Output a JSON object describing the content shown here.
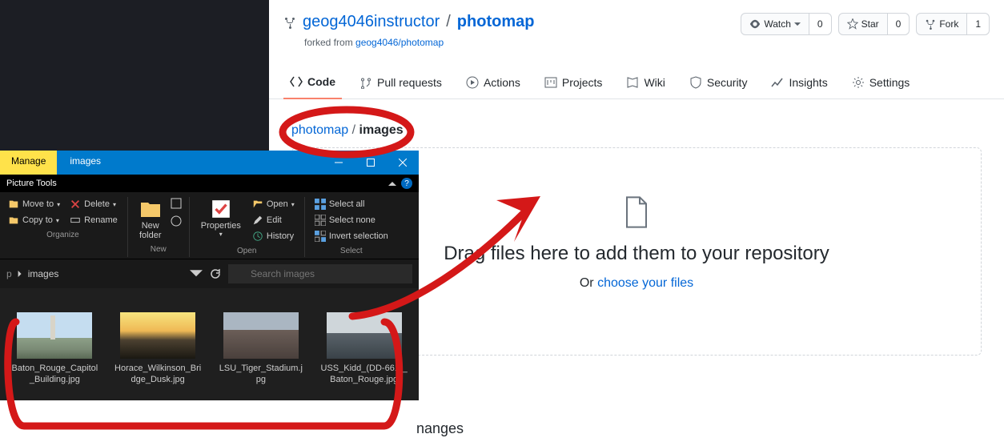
{
  "github": {
    "owner": "geog4046instructor",
    "repo": "photomap",
    "forked_from_prefix": "forked from ",
    "forked_from": "geog4046/photomap",
    "actions": {
      "watch": {
        "label": "Watch",
        "count": "0"
      },
      "star": {
        "label": "Star",
        "count": "0"
      },
      "fork": {
        "label": "Fork",
        "count": "1"
      }
    },
    "tabs": {
      "code": "Code",
      "pulls": "Pull requests",
      "actions": "Actions",
      "projects": "Projects",
      "wiki": "Wiki",
      "security": "Security",
      "insights": "Insights",
      "settings": "Settings"
    },
    "breadcrumb": {
      "root": "photomap",
      "current": "images"
    },
    "drop": {
      "title": "Drag files here to add them to your repository",
      "or": "Or ",
      "choose": "choose your files"
    }
  },
  "explorer": {
    "tab_manage": "Manage",
    "tab_images": "images",
    "subtitle": "Picture Tools",
    "ribbon": {
      "move_to": "Move to",
      "copy_to": "Copy to",
      "delete": "Delete",
      "rename": "Rename",
      "organize": "Organize",
      "new_folder": "New\nfolder",
      "new": "New",
      "properties": "Properties",
      "open_item": "Open",
      "edit": "Edit",
      "history": "History",
      "open": "Open",
      "select_all": "Select all",
      "select_none": "Select none",
      "invert": "Invert selection",
      "select": "Select"
    },
    "crumb_current": "images",
    "search_placeholder": "Search images",
    "files": [
      "Baton_Rouge_Capitol_Building.jpg",
      "Horace_Wilkinson_Bridge_Dusk.jpg",
      "LSU_Tiger_Stadium.jpg",
      "USS_Kidd_(DD-661)_Baton_Rouge.jpg"
    ]
  },
  "misc": {
    "fragment": "nanges"
  }
}
